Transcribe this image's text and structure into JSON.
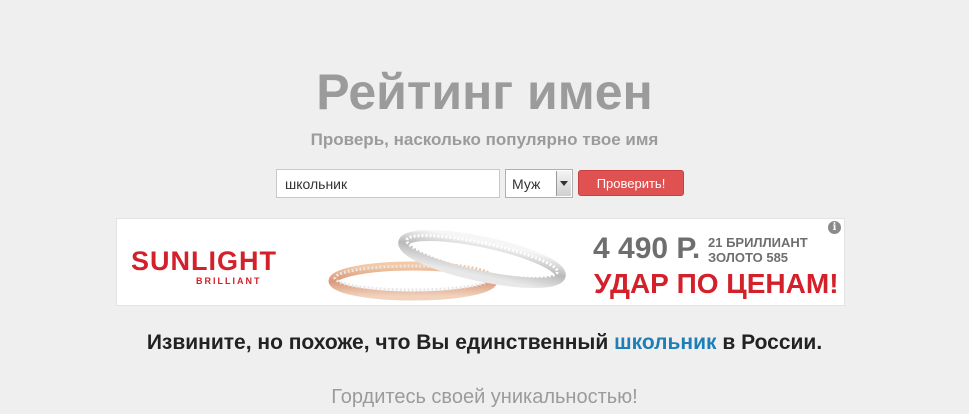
{
  "header": {
    "title": "Рейтинг имен",
    "subtitle": "Проверь, насколько популярно твое имя"
  },
  "search": {
    "name_value": "школьник",
    "gender_value": "Муж",
    "check_label": "Проверить!"
  },
  "ad": {
    "brand": "SUNLIGHT",
    "brand_sub": "BRILLIANT",
    "price": "4 490 Р.",
    "feature_1": "21 БРИЛЛИАНТ",
    "feature_2": "ЗОЛОТО 585",
    "slogan": "УДАР ПО ЦЕНАМ!",
    "info_glyph": "i"
  },
  "result": {
    "prefix": "Извините, но похоже, что Вы единственный ",
    "name": "школьник",
    "suffix": " в России.",
    "subline": "Гордитесь своей уникальностью!"
  },
  "colors": {
    "accent_button": "#e05252",
    "brand_red": "#d3202a",
    "name_link": "#1e7fb8"
  }
}
